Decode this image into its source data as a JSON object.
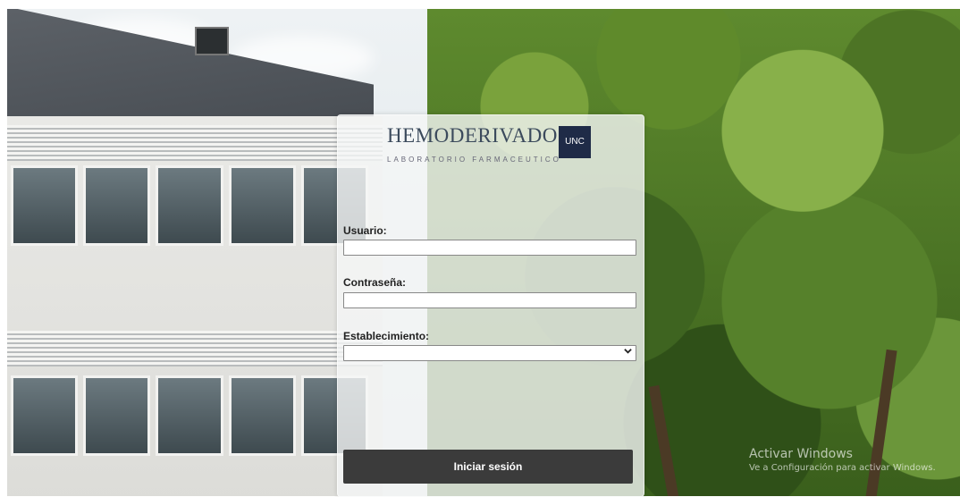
{
  "brand": {
    "name": "HEMODERIVADOS",
    "badge": "UNC",
    "subtitle": "LABORATORIO FARMACEUTICO"
  },
  "form": {
    "username_label": "Usuario:",
    "username_value": "",
    "password_label": "Contraseña:",
    "password_value": "",
    "establishment_label": "Establecimiento:",
    "establishment_selected": "",
    "submit_label": "Iniciar sesión"
  },
  "watermark": {
    "title": "Activar Windows",
    "subtitle": "Ve a Configuración para activar Windows."
  },
  "colors": {
    "button_bg": "#3b3b3b",
    "badge_bg": "#1f2b47",
    "brand_text": "#3b4a5c"
  }
}
